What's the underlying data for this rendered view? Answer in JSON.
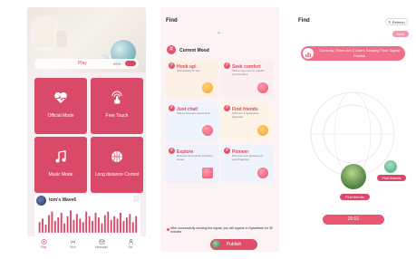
{
  "screen1": {
    "play_label": "Play",
    "play_percent": "99%",
    "modes": [
      {
        "label": "Official Mode",
        "icon": "heart-pulse-icon"
      },
      {
        "label": "Free Touch",
        "icon": "touch-icon"
      },
      {
        "label": "Music Mode",
        "icon": "music-note-icon"
      },
      {
        "label": "Long distance Control",
        "icon": "basketball-icon"
      }
    ],
    "wave_title": "tom's Wave6",
    "wave_levels": [
      0.45,
      0.6,
      0.35,
      0.75,
      0.9,
      0.5,
      0.65,
      0.85,
      0.4,
      0.7,
      0.95,
      0.55,
      0.8,
      0.6,
      0.45,
      0.9,
      0.7,
      0.5,
      0.85,
      0.65,
      0.4,
      0.75,
      0.9,
      0.55,
      0.7,
      0.6,
      0.85,
      0.5,
      0.65,
      0.8,
      0.45,
      0.7
    ],
    "accent": "#d84a68"
  },
  "tabs": [
    {
      "label": "Play",
      "icon": "play-icon"
    },
    {
      "label": "Find",
      "icon": "signal-icon"
    },
    {
      "label": "Message",
      "icon": "message-icon"
    },
    {
      "label": "Me",
      "icon": "user-icon"
    }
  ],
  "screen2": {
    "title": "Find",
    "section": "Current Mood",
    "cards": [
      {
        "title": "Hook up!",
        "desc": "Just looking for sex",
        "emoji_color": "#f2a13a"
      },
      {
        "title": "Seek comfort",
        "desc": "Talk to someone to resolve your troubles",
        "emoji_color": "#e94d6d"
      },
      {
        "title": "Just chat!",
        "desc": "Talk to someone about love",
        "emoji_color": "#e9566f"
      },
      {
        "title": "Find friends",
        "desc": "Summon a Spacetime playmate",
        "emoji_color": "#f2a13a"
      },
      {
        "title": "Explore",
        "desc": "Discover and unlock sensitive zones",
        "emoji_color": "#e9566f"
      },
      {
        "title": "Pioneer",
        "desc": "Discover new pleasure at your fingertips",
        "emoji_color": "#e94d6d"
      }
    ],
    "notice": "After successfully sending the signal, you will appear in Spacetime for 30 minutes",
    "publish": "Publish"
  },
  "screen3": {
    "title": "Find",
    "refresh": "Refresh",
    "new_label": "New",
    "banner": "Currently, There Are 2 Users Sending Their Signal Publish",
    "tag1": "Find friends",
    "tag2": "Find friends",
    "timer": "25:01"
  }
}
